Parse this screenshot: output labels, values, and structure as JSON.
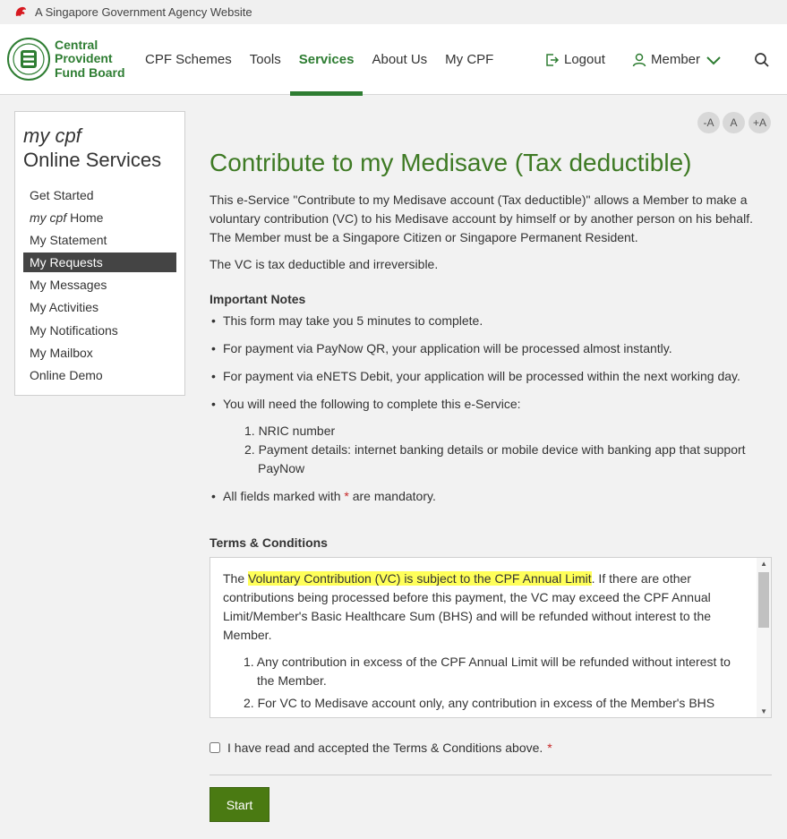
{
  "gov_banner": {
    "text": "A Singapore Government Agency Website"
  },
  "logo": {
    "line1": "Central",
    "line2": "Provident",
    "line3": "Fund Board"
  },
  "nav": {
    "items": [
      {
        "label": "CPF Schemes"
      },
      {
        "label": "Tools"
      },
      {
        "label": "Services",
        "active": true
      },
      {
        "label": "About Us"
      },
      {
        "label": "My CPF"
      }
    ],
    "logout_label": "Logout",
    "member_label": "Member"
  },
  "sidebar": {
    "title_line1": "my cpf",
    "title_line2": "Online Services",
    "items": [
      {
        "label": "Get Started"
      },
      {
        "italic_prefix": "my cpf",
        "label": " Home"
      },
      {
        "label": "My Statement"
      },
      {
        "label": "My Requests",
        "active": true
      },
      {
        "label": "My Messages"
      },
      {
        "label": "My Activities"
      },
      {
        "label": "My Notifications"
      },
      {
        "label": "My Mailbox"
      },
      {
        "label": "Online Demo"
      }
    ]
  },
  "font_controls": {
    "decrease": "-A",
    "normal": "A",
    "increase": "+A"
  },
  "main": {
    "title": "Contribute to my Medisave (Tax deductible)",
    "intro": "This e-Service \"Contribute to my Medisave account (Tax deductible)\" allows a Member to make a voluntary contribution (VC) to his Medisave account by himself or by another person on his behalf. The Member must be a Singapore Citizen or Singapore Permanent Resident.",
    "tax_note": "The VC is tax deductible and irreversible.",
    "notes_heading": "Important Notes",
    "notes": [
      "This form may take you 5 minutes to complete.",
      "For payment via PayNow QR, your application will be processed almost instantly.",
      "For payment via eNETS Debit, your application will be processed within the next working day.",
      "You will need the following to complete this e-Service:"
    ],
    "requirements": [
      "1. NRIC number",
      "2. Payment details: internet banking details or mobile device with banking app that support PayNow"
    ],
    "mandatory_prefix": "All fields marked with ",
    "mandatory_asterisk": "*",
    "mandatory_suffix": " are mandatory.",
    "terms_heading": "Terms & Conditions",
    "terms": {
      "lead": "The ",
      "highlight": "Voluntary Contribution (VC) is subject to the CPF Annual Limit",
      "rest": ". If there are other contributions being processed before this payment, the VC may exceed the CPF Annual Limit/Member's Basic Healthcare Sum (BHS) and will be refunded without interest to the Member.",
      "points": [
        "1. Any contribution in excess of the CPF Annual Limit will be refunded without interest to the Member.",
        "2. For VC to Medisave account only, any contribution in excess of the Member's BHS"
      ]
    },
    "accept_label": "I have read and accepted the Terms & Conditions above.",
    "accept_asterisk": "*",
    "start_label": "Start"
  }
}
